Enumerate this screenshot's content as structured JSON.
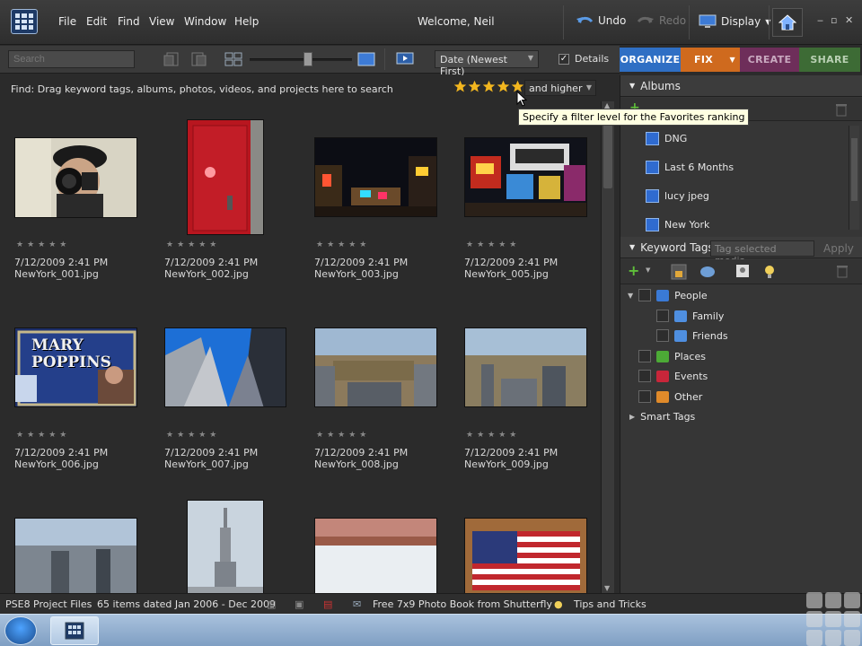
{
  "menu": {
    "items": [
      "File",
      "Edit",
      "Find",
      "View",
      "Window",
      "Help"
    ],
    "welcome": "Welcome, Neil",
    "undo": "Undo",
    "redo": "Redo",
    "display": "Display"
  },
  "toolbar": {
    "search_placeholder": "Search",
    "sort": "Date (Newest First)",
    "details_label": "Details",
    "details_checked": true,
    "zoom_level": 0.58
  },
  "tabs": [
    {
      "label": "ORGANIZE",
      "color": "#2f6fc4",
      "active": true
    },
    {
      "label": "FIX",
      "color": "#cf6a1e",
      "active": false
    },
    {
      "label": "CREATE",
      "color": "#6e2e5a",
      "active": false
    },
    {
      "label": "SHARE",
      "color": "#3d6b35",
      "active": false
    }
  ],
  "find": {
    "text": "Find: Drag keyword tags, albums, photos, videos, and projects here to search",
    "rating_stars": 5,
    "rating_filter": "and higher",
    "tooltip": "Specify a filter level for the Favorites ranking"
  },
  "photos": [
    {
      "date": "7/12/2009 2:41 PM",
      "name": "NewYork_001.jpg",
      "subject": "photographer-selfie"
    },
    {
      "date": "7/12/2009 2:41 PM",
      "name": "NewYork_002.jpg",
      "subject": "red-door"
    },
    {
      "date": "7/12/2009 2:41 PM",
      "name": "NewYork_003.jpg",
      "subject": "times-square-night"
    },
    {
      "date": "7/12/2009 2:41 PM",
      "name": "NewYork_005.jpg",
      "subject": "times-square-billboards"
    },
    {
      "date": "7/12/2009 2:41 PM",
      "name": "NewYork_006.jpg",
      "subject": "mary-poppins-sign"
    },
    {
      "date": "7/12/2009 2:41 PM",
      "name": "NewYork_007.jpg",
      "subject": "skyscrapers-blue-sky"
    },
    {
      "date": "7/12/2009 2:41 PM",
      "name": "NewYork_008.jpg",
      "subject": "central-park-aerial"
    },
    {
      "date": "7/12/2009 2:41 PM",
      "name": "NewYork_009.jpg",
      "subject": "central-park-skyline"
    },
    {
      "date": "",
      "name": "",
      "subject": "city-aerial"
    },
    {
      "date": "",
      "name": "",
      "subject": "empire-state-building"
    },
    {
      "date": "",
      "name": "",
      "subject": "ice-rink"
    },
    {
      "date": "",
      "name": "",
      "subject": "american-flag"
    }
  ],
  "albums": {
    "title": "Albums",
    "items": [
      "DNG",
      "Last 6 Months",
      "lucy jpeg",
      "New York"
    ]
  },
  "keyword_tags": {
    "title": "Keyword Tags",
    "search_placeholder": "Tag selected media",
    "apply": "Apply",
    "people": "People",
    "family": "Family",
    "friends": "Friends",
    "places": "Places",
    "events": "Events",
    "other": "Other",
    "smart_tags": "Smart Tags"
  },
  "status": {
    "catalog": "PSE8 Project Files",
    "summary": "65 items dated Jan 2006 - Dec 2009",
    "promo": "Free 7x9 Photo Book from Shutterfly",
    "tips": "Tips and Tricks"
  },
  "icons": {
    "star_color": "#f2b61f"
  }
}
